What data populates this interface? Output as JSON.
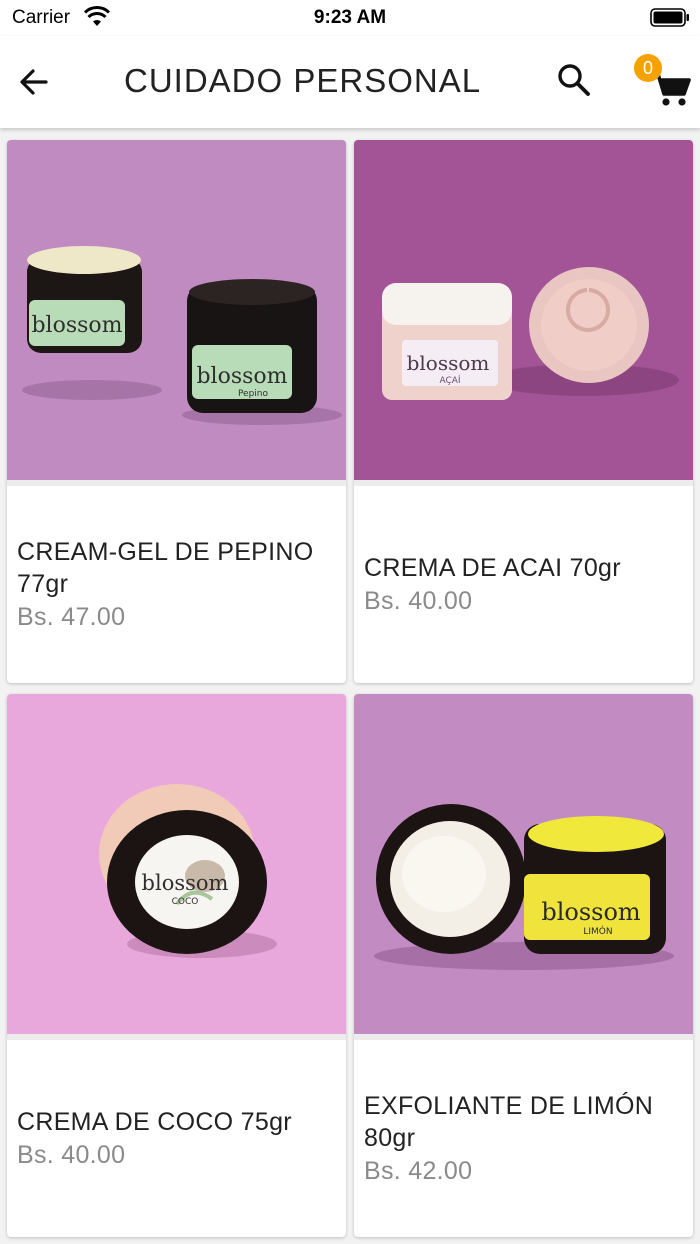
{
  "status_bar": {
    "carrier": "Carrier",
    "time": "9:23 AM"
  },
  "app_bar": {
    "title": "CUIDADO PERSONAL",
    "cart_count": "0"
  },
  "colors": {
    "badge": "#f5a100",
    "price": "#8a8a8a",
    "image_backgrounds": [
      "#c08bc0",
      "#a25497",
      "#e8a8dc",
      "#c28bc1"
    ]
  },
  "products": [
    {
      "name": "CREAM-GEL DE PEPINO 77gr",
      "price": "Bs. 47.00",
      "image_label": "blossom",
      "image_sublabel": "Pepino"
    },
    {
      "name": "CREMA DE ACAI 70gr",
      "price": "Bs. 40.00",
      "image_label": "blossom",
      "image_sublabel": "AÇAÍ"
    },
    {
      "name": "CREMA DE COCO 75gr",
      "price": "Bs. 40.00",
      "image_label": "blossom",
      "image_sublabel": "COCO"
    },
    {
      "name": "EXFOLIANTE DE LIMÓN 80gr",
      "price": "Bs. 42.00",
      "image_label": "blossom",
      "image_sublabel": "LIMÓN"
    }
  ]
}
